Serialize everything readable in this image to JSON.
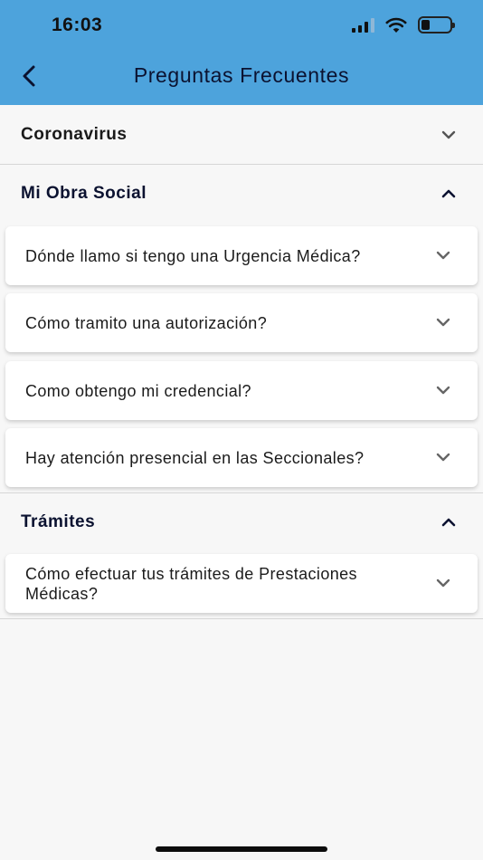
{
  "status_bar": {
    "time": "16:03"
  },
  "header": {
    "title": "Preguntas Frecuentes"
  },
  "colors": {
    "header_bg": "#4da3dc",
    "section_title_dark": "#0b1230",
    "section_title_black": "#1a1a1a"
  },
  "sections": [
    {
      "title": "Coronavirus",
      "expanded": false,
      "items": []
    },
    {
      "title": "Mi Obra Social",
      "expanded": true,
      "items": [
        {
          "question": "Dónde llamo si tengo una Urgencia Médica?"
        },
        {
          "question": "Cómo tramito una autorización?"
        },
        {
          "question": "Como obtengo mi credencial?"
        },
        {
          "question": "Hay atención presencial en las Seccionales?"
        }
      ]
    },
    {
      "title": "Trámites",
      "expanded": true,
      "items": [
        {
          "question": "Cómo efectuar tus trámites de Prestaciones Médicas?"
        }
      ]
    }
  ]
}
